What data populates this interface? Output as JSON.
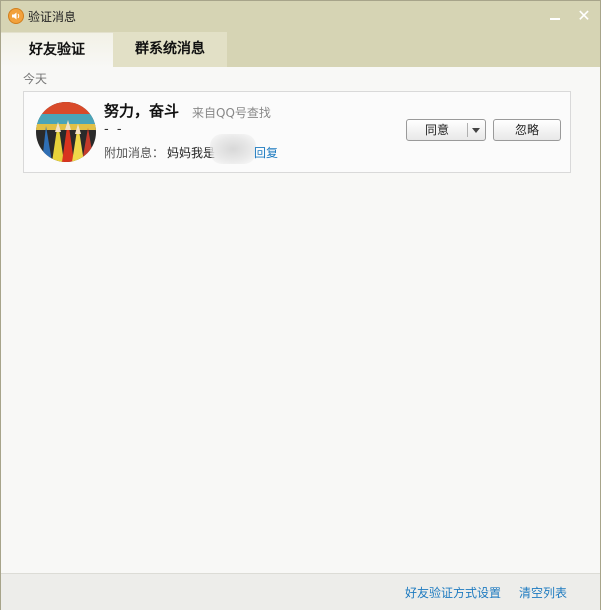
{
  "window": {
    "title": "验证消息"
  },
  "tabs": [
    {
      "label": "好友验证",
      "active": true
    },
    {
      "label": "群系统消息",
      "active": false
    }
  ],
  "section": {
    "label": "今天"
  },
  "request": {
    "name": "努力，奋斗",
    "source": "来自QQ号查找",
    "remark": "-  -",
    "attach_label": "附加消息：",
    "attach_message": "妈妈我是",
    "reply_label": "回复",
    "agree_label": "同意",
    "ignore_label": "忽略"
  },
  "footer": {
    "settings_link": "好友验证方式设置",
    "clear_link": "清空列表"
  },
  "colors": {
    "titlebar": "#d6d4b4",
    "link": "#1e7bc0",
    "app_icon": "#f2a13c"
  },
  "icons": {
    "app": "speaker-icon",
    "minimize": "minimize-icon",
    "close": "close-icon",
    "dropdown": "chevron-down-icon"
  }
}
